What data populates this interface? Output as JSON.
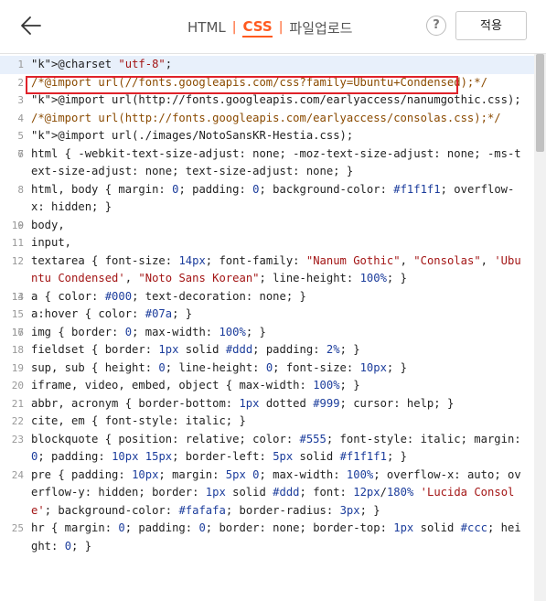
{
  "header": {
    "tabs": [
      {
        "label": "HTML",
        "active": false
      },
      {
        "label": "CSS",
        "active": true
      },
      {
        "label": "파일업로드",
        "active": false
      }
    ],
    "separator": "|",
    "help_label": "?",
    "apply_label": "적용"
  },
  "editor": {
    "lines": [
      {
        "n": "1",
        "text": "@charset \"utf-8\";",
        "active": true
      },
      {
        "n": "2",
        "text": "/*@import url(//fonts.googleapis.com/css?family=Ubuntu+Condensed);*/"
      },
      {
        "n": "3",
        "text": "@import url(http://fonts.googleapis.com/earlyaccess/nanumgothic.css);"
      },
      {
        "n": "4",
        "text": "/*@import url(http://fonts.googleapis.com/earlyaccess/consolas.css);*/"
      },
      {
        "n": "5",
        "text": "@import url(./images/NotoSansKR-Hestia.css);"
      },
      {
        "n": "6",
        "text": ""
      },
      {
        "n": "7",
        "text": "html { -webkit-text-size-adjust: none; -moz-text-size-adjust: none; -ms-text-size-adjust: none; text-size-adjust: none; }"
      },
      {
        "n": "8",
        "text": "html, body { margin: 0; padding: 0; background-color: #f1f1f1; overflow-x: hidden; }"
      },
      {
        "n": "9",
        "text": ""
      },
      {
        "n": "10",
        "text": "body,"
      },
      {
        "n": "11",
        "text": "input,"
      },
      {
        "n": "12",
        "text": "textarea { font-size: 14px; font-family: \"Nanum Gothic\", \"Consolas\", 'Ubuntu Condensed', \"Noto Sans Korean\"; line-height: 100%; }"
      },
      {
        "n": "13",
        "text": ""
      },
      {
        "n": "14",
        "text": "a { color: #000; text-decoration: none; }"
      },
      {
        "n": "15",
        "text": "a:hover { color: #07a; }"
      },
      {
        "n": "16",
        "text": ""
      },
      {
        "n": "17",
        "text": "img { border: 0; max-width: 100%; }"
      },
      {
        "n": "18",
        "text": "fieldset { border: 1px solid #ddd; padding: 2%; }"
      },
      {
        "n": "19",
        "text": "sup, sub { height: 0; line-height: 0; font-size: 10px; }"
      },
      {
        "n": "20",
        "text": "iframe, video, embed, object { max-width: 100%; }"
      },
      {
        "n": "21",
        "text": "abbr, acronym { border-bottom: 1px dotted #999; cursor: help; }"
      },
      {
        "n": "22",
        "text": "cite, em { font-style: italic; }"
      },
      {
        "n": "23",
        "text": "blockquote { position: relative; color: #555; font-style: italic; margin: 0; padding: 10px 15px; border-left: 5px solid #f1f1f1; }"
      },
      {
        "n": "24",
        "text": "pre { padding: 10px; margin: 5px 0; max-width: 100%; overflow-x: auto; overflow-y: hidden; border: 1px solid #ddd; font: 12px/180% 'Lucida Console'; background-color: #fafafa; border-radius: 3px; }"
      },
      {
        "n": "25",
        "text": "hr { margin: 0; padding: 0; border: none; border-top: 1px solid #ccc; height: 0; }"
      }
    ]
  },
  "colors": {
    "accent": "#ff5a1f",
    "highlight_box": "#e0222a",
    "active_line": "#e8f0fb"
  }
}
